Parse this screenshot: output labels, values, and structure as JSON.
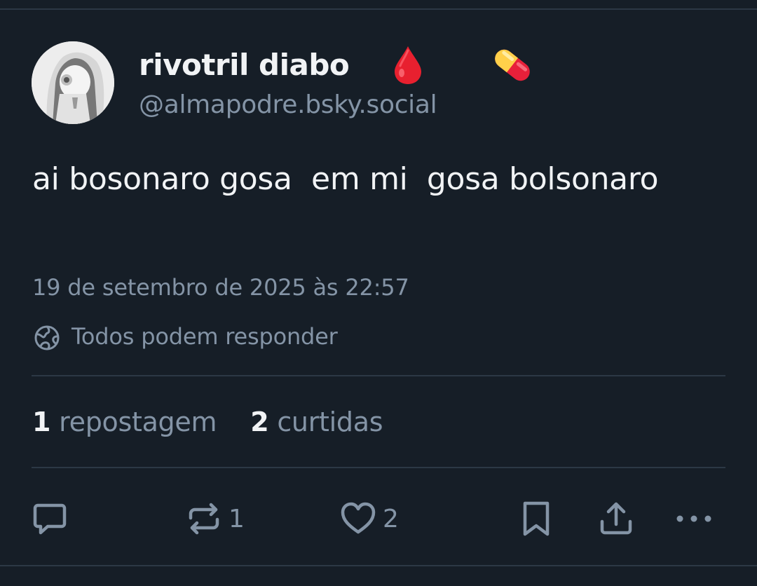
{
  "author": {
    "display_name": "rivotril diabo",
    "emojis": [
      "drop-of-blood-icon",
      "pill-icon"
    ],
    "handle": "@almapodre.bsky.social"
  },
  "post": {
    "text": "ai bosonaro gosa  em mi  gosa bolsonaro",
    "timestamp": "19 de setembro de 2025 às 22:57",
    "reply_setting": "Todos podem responder"
  },
  "stats": {
    "reposts_count": "1",
    "reposts_label": "repostagem",
    "likes_count": "2",
    "likes_label": "curtidas"
  },
  "actions": {
    "repost_count": "1",
    "like_count": "2"
  },
  "colors": {
    "background": "#161e27",
    "text": "#f1f3f5",
    "muted": "#8494a6",
    "divider": "#2c3845"
  }
}
